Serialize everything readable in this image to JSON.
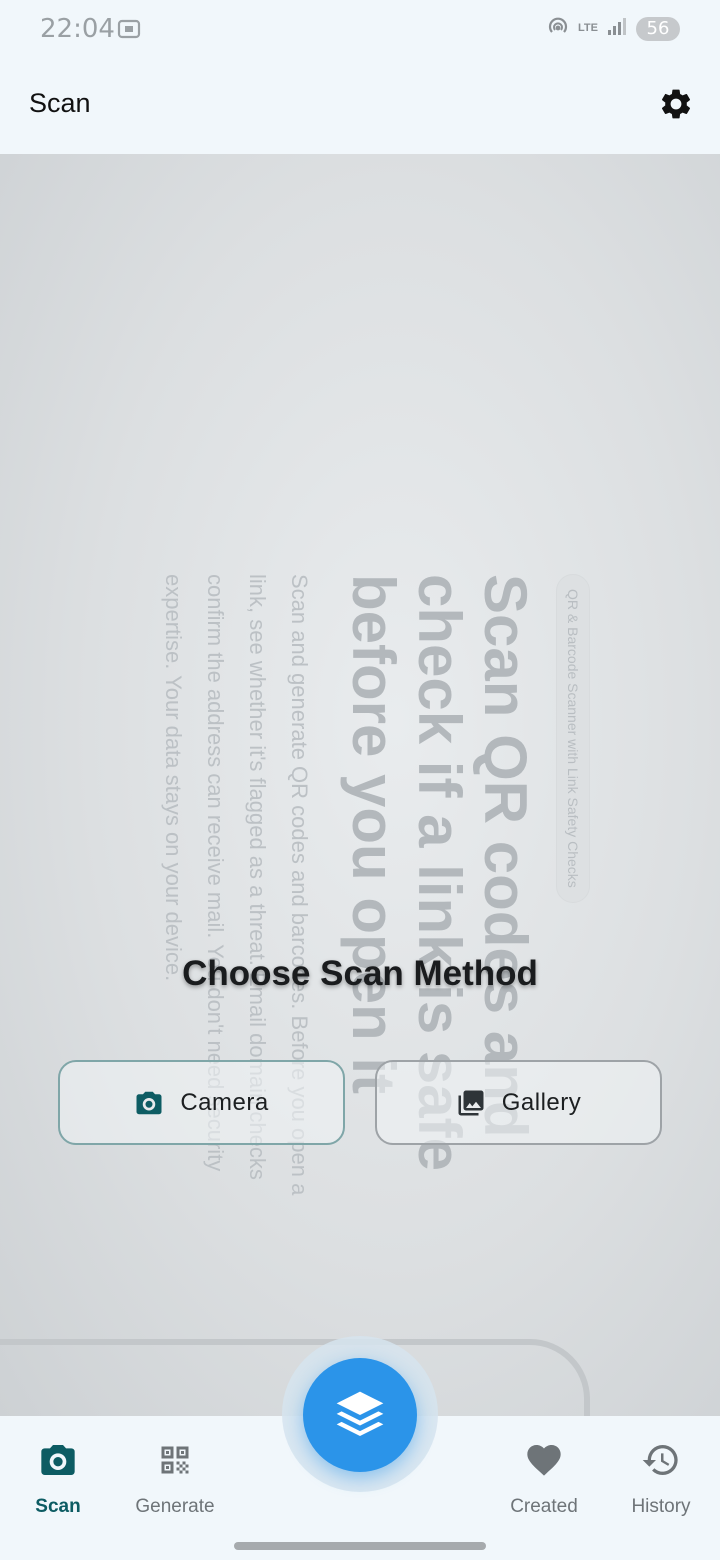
{
  "status_bar": {
    "time": "22:04",
    "network": "LTE",
    "battery": "56"
  },
  "app_bar": {
    "title": "Scan"
  },
  "preview": {
    "badge": "QR & Barcode Scanner with Link Safety Checks",
    "heading": "Scan QR codes and check if a link is safe before you open it",
    "body": "Scan and generate QR codes and barcodes. Before you open a link, see whether it's flagged as a threat. Email domain checks confirm the address can receive mail. You don't need security expertise. Your data stays on your device."
  },
  "scan_method": {
    "title": "Choose Scan Method",
    "camera_label": "Camera",
    "gallery_label": "Gallery"
  },
  "bottom_nav": {
    "items": [
      {
        "label": "Scan",
        "icon": "camera-icon",
        "active": true
      },
      {
        "label": "Generate",
        "icon": "qr-code-icon",
        "active": false
      },
      {
        "label": "Created",
        "icon": "heart-icon",
        "active": false
      },
      {
        "label": "History",
        "icon": "history-icon",
        "active": false
      }
    ],
    "fab_icon": "layers-icon"
  },
  "colors": {
    "accent": "#0d5c63",
    "fab": "#2b94e9",
    "background": "#f1f7fb"
  }
}
